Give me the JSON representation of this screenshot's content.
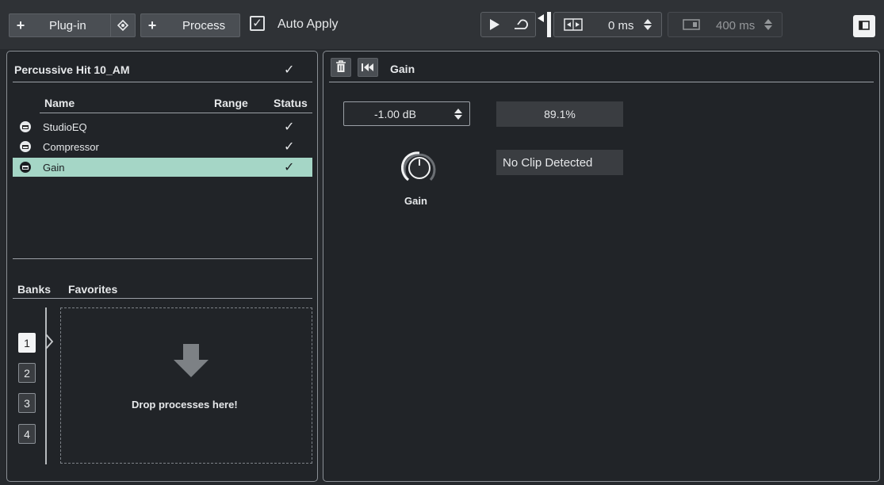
{
  "toolbar": {
    "plugin_label": "Plug-in",
    "process_label": "Process",
    "auto_apply_label": "Auto Apply",
    "auto_apply_checked": "✓",
    "pre_time": "0 ms",
    "post_time": "400 ms"
  },
  "left_panel": {
    "title": "Percussive Hit 10_AM",
    "title_check": "✓",
    "columns": {
      "name": "Name",
      "range": "Range",
      "status": "Status"
    },
    "items": [
      {
        "name": "StudioEQ",
        "status": "✓"
      },
      {
        "name": "Compressor",
        "status": "✓"
      },
      {
        "name": "Gain",
        "status": "✓"
      }
    ],
    "tabs": {
      "banks": "Banks",
      "favorites": "Favorites"
    },
    "banks": [
      "1",
      "2",
      "3",
      "4"
    ],
    "drop_text": "Drop processes here!"
  },
  "right_panel": {
    "title": "Gain",
    "gain_value": "-1.00 dB",
    "percent": "89.1%",
    "clip_status": "No Clip Detected",
    "knob_label": "Gain"
  },
  "icons": {
    "play": "play-icon",
    "loop": "loop-icon",
    "trash": "trash-icon",
    "skip_back": "skip-back-icon",
    "layout": "panel-layout-icon"
  },
  "colors": {
    "selection": "#a5d6c6",
    "background": "#26292d",
    "panel": "#212428"
  }
}
